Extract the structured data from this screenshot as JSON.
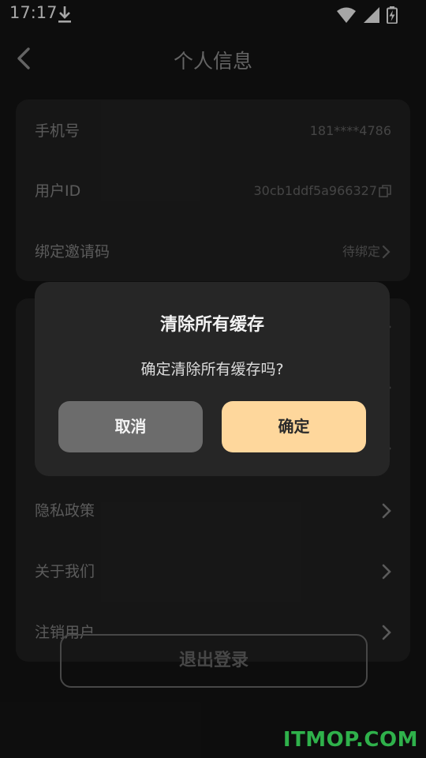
{
  "status_bar": {
    "time": "17:17",
    "icons": [
      "download-icon",
      "wifi-icon",
      "signal-icon",
      "battery-charging-icon"
    ]
  },
  "header": {
    "title": "个人信息",
    "back_icon": "chevron-left-icon"
  },
  "account_card": {
    "rows": [
      {
        "label": "手机号",
        "value": "181****4786"
      },
      {
        "label": "用户ID",
        "value": "30cb1ddf5a966327",
        "icon": "copy-icon"
      },
      {
        "label": "绑定邀请码",
        "value": "待绑定",
        "icon": "chevron-right-icon"
      }
    ]
  },
  "settings_card": {
    "rows": [
      {
        "label": "隐私政策"
      },
      {
        "label": "关于我们"
      },
      {
        "label": "注销用户"
      }
    ]
  },
  "logout_button": {
    "label": "退出登录"
  },
  "dialog": {
    "title": "清除所有缓存",
    "message": "确定清除所有缓存吗?",
    "cancel_label": "取消",
    "confirm_label": "确定"
  },
  "watermark": "ITMOP.COM",
  "colors": {
    "background": "#151515",
    "card": "#232323",
    "dialog": "#262626",
    "confirm_button": "#fed79c",
    "cancel_button": "#6c6c6c",
    "watermark": "#2fb14b"
  }
}
